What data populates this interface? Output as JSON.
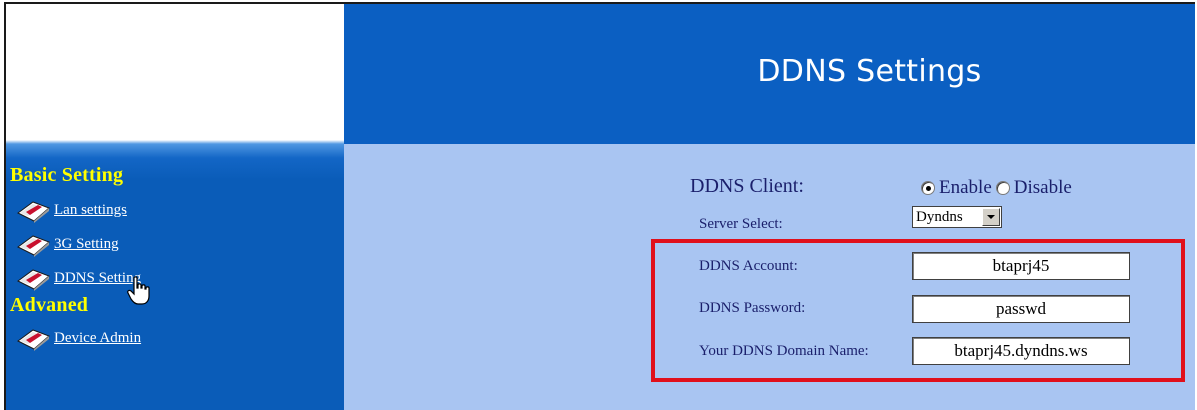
{
  "header": {
    "title": "DDNS Settings"
  },
  "sidebar": {
    "sections": [
      {
        "label": "Basic Setting"
      },
      {
        "label": "Advaned"
      }
    ],
    "items": [
      {
        "label": "Lan settings",
        "icon": "router-icon"
      },
      {
        "label": "3G Setting",
        "icon": "router-icon"
      },
      {
        "label": "DDNS Setting",
        "icon": "router-icon"
      },
      {
        "label": "Device Admin",
        "icon": "router-icon"
      }
    ]
  },
  "form": {
    "client_label": "DDNS Client:",
    "enable_label": "Enable",
    "disable_label": "Disable",
    "client_selected": "Enable",
    "server_label": "Server Select:",
    "server_value": "Dyndns",
    "account_label": "DDNS Account:",
    "account_value": "btaprj45",
    "password_label": "DDNS Password:",
    "password_value": "passwd",
    "domain_label": "Your DDNS Domain Name:",
    "domain_value": "btaprj45.dyndns.ws"
  },
  "colors": {
    "header_blue": "#0b5fc2",
    "content_bg": "#a9c5f2",
    "section_yellow": "#ffff00",
    "highlight_red": "#e0101c"
  }
}
